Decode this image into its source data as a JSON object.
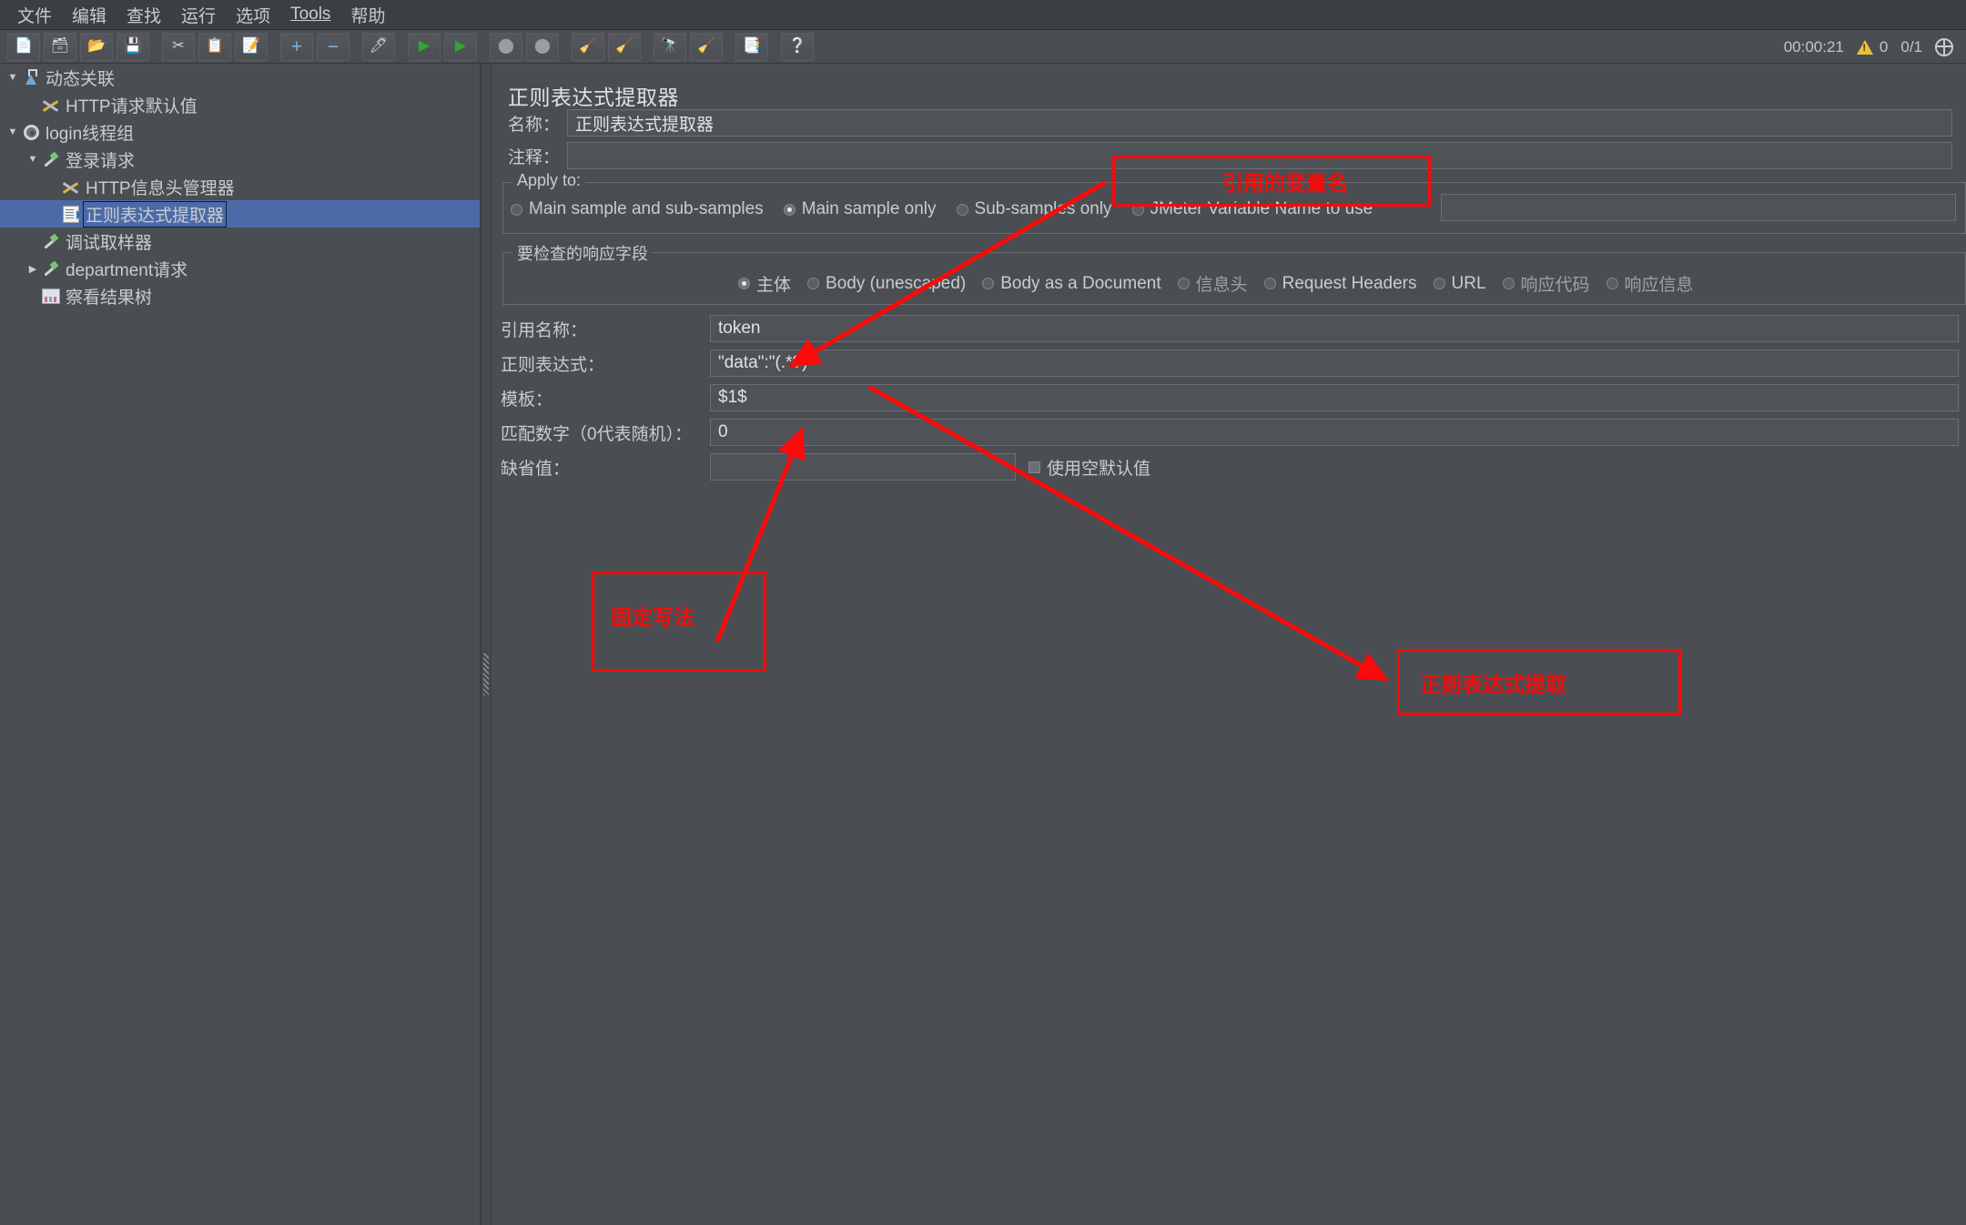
{
  "menu": {
    "items": [
      {
        "label": "文件"
      },
      {
        "label": "编辑"
      },
      {
        "label": "查找"
      },
      {
        "label": "运行"
      },
      {
        "label": "选项"
      },
      {
        "label": "Tools"
      },
      {
        "label": "帮助"
      }
    ]
  },
  "toolbar": {
    "buttons": [
      {
        "name": "new-test-plan-button",
        "icon": "new-document-icon",
        "glyph": "📄"
      },
      {
        "name": "templates-button",
        "icon": "templates-icon",
        "glyph": "🗃"
      },
      {
        "name": "open-button",
        "icon": "open-folder-icon",
        "glyph": "📂"
      },
      {
        "name": "save-button",
        "icon": "save-disk-icon",
        "glyph": "💾"
      },
      {
        "name": "cut-button",
        "icon": "scissors-icon",
        "glyph": "✂"
      },
      {
        "name": "copy-button",
        "icon": "copy-icon",
        "glyph": "📋"
      },
      {
        "name": "paste-button",
        "icon": "paste-clipboard-icon",
        "glyph": "📝"
      },
      {
        "name": "expand-all-button",
        "icon": "plus-icon",
        "glyph": "+"
      },
      {
        "name": "collapse-all-button",
        "icon": "minus-icon",
        "glyph": "−"
      },
      {
        "name": "toggle-button",
        "icon": "toggle-pencil-icon",
        "glyph": "🖊"
      },
      {
        "name": "start-button",
        "icon": "play-green-icon",
        "glyph": "▶"
      },
      {
        "name": "start-no-pauses-button",
        "icon": "play-no-pause-icon",
        "glyph": "▶"
      },
      {
        "name": "stop-button",
        "icon": "stop-circle-icon",
        "glyph": "⬤"
      },
      {
        "name": "shutdown-button",
        "icon": "shutdown-circle-icon",
        "glyph": "⬤"
      },
      {
        "name": "clear-button",
        "icon": "broom-clear-icon",
        "glyph": "🧹"
      },
      {
        "name": "clear-all-button",
        "icon": "broom-clear-all-icon",
        "glyph": "🧹"
      },
      {
        "name": "search-button",
        "icon": "binoculars-icon",
        "glyph": "🔭"
      },
      {
        "name": "reset-search-button",
        "icon": "reset-broom-icon",
        "glyph": "🧹"
      },
      {
        "name": "function-helper-button",
        "icon": "list-notes-icon",
        "glyph": "📑"
      },
      {
        "name": "help-button",
        "icon": "question-book-icon",
        "glyph": "❔"
      }
    ],
    "status": {
      "elapsed": "00:00:21",
      "warnings": "0",
      "threads": "0/1"
    }
  },
  "tree": {
    "nodes": [
      {
        "label": "动态关联",
        "indent": 0,
        "toggle": "▼",
        "icon": "test-plan-flask-icon",
        "selected": false
      },
      {
        "label": "HTTP请求默认值",
        "indent": 1,
        "toggle": "",
        "icon": "config-tools-icon",
        "selected": false
      },
      {
        "label": "login线程组",
        "indent": 0,
        "toggle": "▼",
        "icon": "thread-group-gear-icon",
        "selected": false
      },
      {
        "label": "登录请求",
        "indent": 1,
        "toggle": "▼",
        "icon": "http-sampler-pipette-icon",
        "selected": false
      },
      {
        "label": "HTTP信息头管理器",
        "indent": 2,
        "toggle": "",
        "icon": "header-manager-tools-icon",
        "selected": false
      },
      {
        "label": "正则表达式提取器",
        "indent": 2,
        "toggle": "",
        "icon": "post-processor-doc-icon",
        "selected": true
      },
      {
        "label": "调试取样器",
        "indent": 1,
        "toggle": "",
        "icon": "debug-sampler-pipette-icon",
        "selected": false
      },
      {
        "label": "department请求",
        "indent": 1,
        "toggle": "▶",
        "icon": "http-sampler-pipette-icon",
        "selected": false
      },
      {
        "label": "察看结果树",
        "indent": 1,
        "toggle": "",
        "icon": "view-results-tree-icon",
        "selected": false
      }
    ]
  },
  "detail": {
    "title": "正则表达式提取器",
    "name_label": "名称：",
    "name_value": "正则表达式提取器",
    "comment_label": "注释：",
    "comment_value": "",
    "apply_to": {
      "title": "Apply to:",
      "options": [
        {
          "label": "Main sample and sub-samples",
          "selected": false
        },
        {
          "label": "Main sample only",
          "selected": true
        },
        {
          "label": "Sub-samples only",
          "selected": false
        },
        {
          "label": "JMeter Variable Name to use",
          "selected": false
        }
      ],
      "variable_value": ""
    },
    "response_field": {
      "title": "要检查的响应字段",
      "options": [
        {
          "label": "主体",
          "selected": true
        },
        {
          "label": "Body (unescaped)",
          "selected": false
        },
        {
          "label": "Body as a Document",
          "selected": false
        },
        {
          "label": "信息头",
          "selected": false
        },
        {
          "label": "Request Headers",
          "selected": false
        },
        {
          "label": "URL",
          "selected": false
        },
        {
          "label": "响应代码",
          "selected": false
        },
        {
          "label": "响应信息",
          "selected": false
        }
      ]
    },
    "fields": [
      {
        "label": "引用名称：",
        "value": "token",
        "name": "reference-name-input"
      },
      {
        "label": "正则表达式：",
        "value": "\"data\":\"(.*?)\"",
        "name": "regular-expression-input"
      },
      {
        "label": "模板：",
        "value": "$1$",
        "name": "template-input"
      },
      {
        "label": "匹配数字（0代表随机）：",
        "value": "0",
        "name": "match-number-input"
      },
      {
        "label": "缺省值：",
        "value": "",
        "name": "default-value-input"
      }
    ],
    "use_empty_default_label": "使用空默认值",
    "use_empty_default_checked": false
  },
  "annotations": {
    "color": "#fa0a0a",
    "boxes": [
      {
        "text": "引用的变量名",
        "name": "annotation-reference-variable-name"
      },
      {
        "text": "固定写法",
        "name": "annotation-fixed-syntax"
      },
      {
        "text": "正则表达式提取",
        "name": "annotation-regex-extract"
      }
    ]
  }
}
